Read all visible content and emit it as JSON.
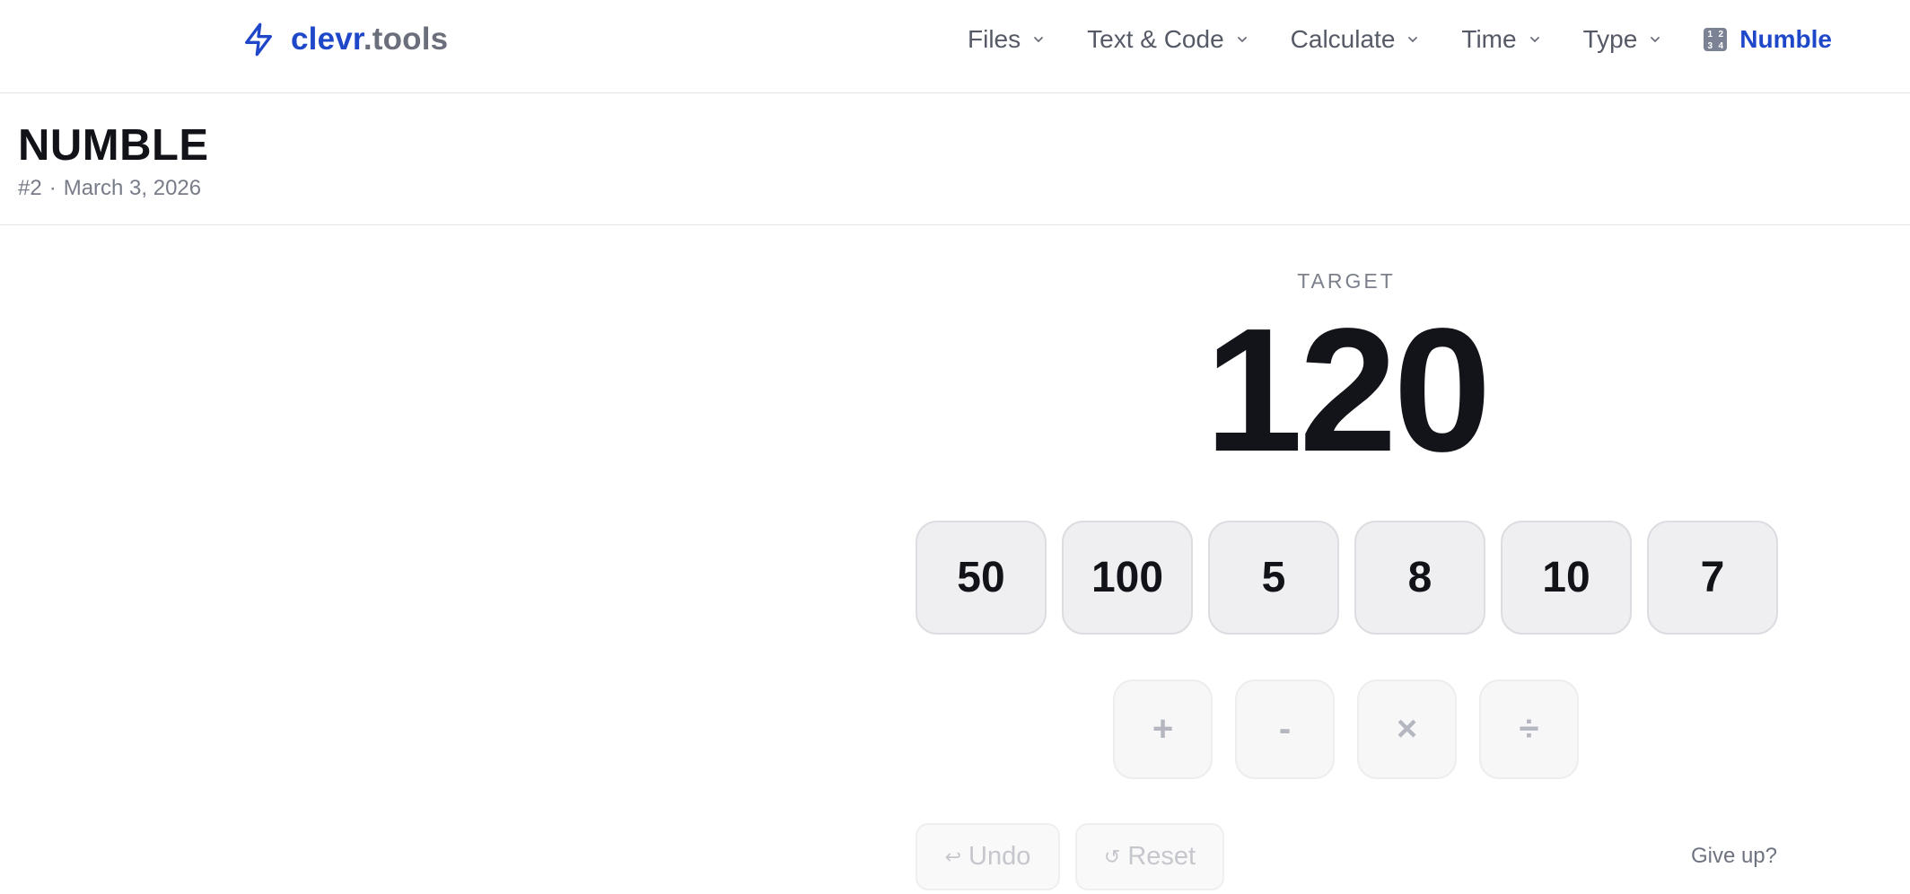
{
  "header": {
    "logo": {
      "brand": "clevr",
      "tld": ".tools",
      "icon": "lightning-bolt-icon",
      "color": "#1f47c9"
    },
    "nav": [
      {
        "label": "Files",
        "icon": "chevron-down-icon"
      },
      {
        "label": "Text & Code",
        "icon": "chevron-down-icon"
      },
      {
        "label": "Calculate",
        "icon": "chevron-down-icon"
      },
      {
        "label": "Time",
        "icon": "chevron-down-icon"
      },
      {
        "label": "Type",
        "icon": "chevron-down-icon"
      }
    ],
    "active": {
      "label": "Numble",
      "icon": "input-numbers-icon",
      "icon_glyph": [
        "1",
        "2",
        "3",
        "4"
      ]
    }
  },
  "page": {
    "title": "NUMBLE",
    "puzzle_number": "#2",
    "separator": "·",
    "date": "March 3, 2026"
  },
  "game": {
    "target_label": "TARGET",
    "target": "120",
    "tiles": [
      "50",
      "100",
      "5",
      "8",
      "10",
      "7"
    ],
    "operators": [
      "+",
      "-",
      "×",
      "÷"
    ],
    "undo": {
      "symbol": "↩",
      "label": "Undo"
    },
    "reset": {
      "symbol": "↺",
      "label": "Reset"
    },
    "give_up": "Give up?"
  },
  "colors": {
    "accent": "#1f47c9",
    "tile_bg": "#efeff1",
    "operator_disabled": "#b4b7c0",
    "text_muted": "#777c88"
  }
}
